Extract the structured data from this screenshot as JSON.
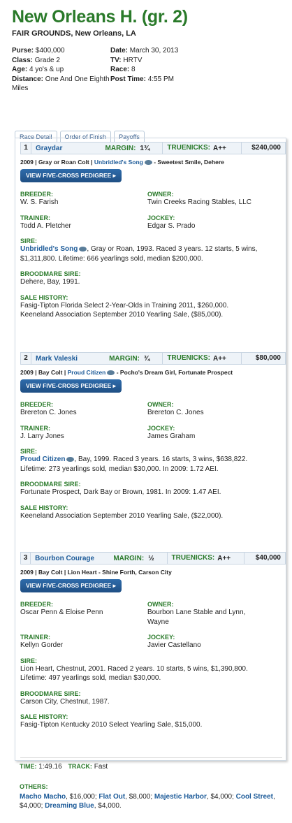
{
  "title": "New Orleans H. (gr. 2)",
  "location": "FAIR GROUNDS, New Orleans, LA",
  "info": {
    "purse_label": "Purse:",
    "purse": "$400,000",
    "class_label": "Class:",
    "class": "Grade 2",
    "age_label": "Age:",
    "age": "4 yo's & up",
    "distance_label": "Distance:",
    "distance": "One And One Eighth Miles",
    "date_label": "Date:",
    "date": "March 30, 2013",
    "tv_label": "TV:",
    "tv": "HRTV",
    "race_label": "Race:",
    "race": "8",
    "post_label": "Post Time:",
    "post": "4:55 PM"
  },
  "tabs": [
    "Race Detail",
    "Order of Finish",
    "Payoffs"
  ],
  "labels": {
    "margin": "MARGIN:",
    "truenicks": "TRUENICKS:",
    "pedigree_btn": "VIEW FIVE-CROSS PEDIGREE ▸",
    "breeder": "BREEDER:",
    "owner": "OWNER:",
    "trainer": "TRAINER:",
    "jockey": "JOCKEY:",
    "sire": "SIRE:",
    "broodmare": "BROODMARE SIRE:",
    "sale": "SALE HISTORY:"
  },
  "horses": [
    {
      "pos": "1",
      "name": "Graydar",
      "margin": "1¾",
      "truenicks": "A++",
      "prize": "$240,000",
      "ped_prefix": "2009 | Gray or Roan Colt | ",
      "ped_sire": "Unbridled's Song",
      "ped_rest": " - Sweetest Smile, Dehere",
      "breeder": "W. S. Farish",
      "owner": "Twin Creeks Racing Stables, LLC",
      "trainer": "Todd A. Pletcher",
      "jockey": "Edgar S. Prado",
      "sire_name": "Unbridled's Song",
      "sire_line1": ", Gray or Roan, 1993. Raced 3 years. 12 starts, 5 wins,",
      "sire_line2": "$1,311,800. Lifetime: 666 yearlings sold, median $200,000.",
      "broodmare": "Dehere, Bay, 1991.",
      "sale1": "Fasig-Tipton Florida Select 2-Year-Olds in Training 2011, $260,000.",
      "sale2": "Keeneland Association September 2010 Yearling Sale, ($85,000)."
    },
    {
      "pos": "2",
      "name": "Mark Valeski",
      "margin": "¾",
      "truenicks": "A++",
      "prize": "$80,000",
      "ped_prefix": "2009 | Bay Colt | ",
      "ped_sire": "Proud Citizen",
      "ped_rest": " - Pocho's Dream Girl, Fortunate Prospect",
      "breeder": "Brereton C. Jones",
      "owner": "Brereton C. Jones",
      "trainer": "J. Larry Jones",
      "jockey": "James Graham",
      "sire_name": "Proud Citizen",
      "sire_line1": ", Bay, 1999. Raced 3 years. 16 starts, 3 wins, $638,822.",
      "sire_line2": "Lifetime: 273 yearlings sold, median $30,000. In 2009: 1.72 AEI.",
      "broodmare": "Fortunate Prospect, Dark Bay or Brown, 1981. In 2009: 1.47 AEI.",
      "sale1": "Keeneland Association September 2010 Yearling Sale, ($22,000).",
      "sale2": ""
    },
    {
      "pos": "3",
      "name": "Bourbon Courage",
      "margin": "½",
      "truenicks": "A++",
      "prize": "$40,000",
      "ped_prefix": "2009 | Bay Colt | Lion Heart - Shine Forth, Carson City",
      "breeder": "Oscar Penn & Eloise Penn",
      "owner1": "Bourbon Lane Stable and Lynn,",
      "owner2": "Wayne",
      "trainer": "Kellyn Gorder",
      "jockey": "Javier Castellano",
      "sire_line1": "Lion Heart, Chestnut, 2001. Raced 2 years. 10 starts, 5 wins, $1,390,800.",
      "sire_line2": "Lifetime: 497 yearlings sold, median $30,000.",
      "broodmare": "Carson City, Chestnut, 1987.",
      "sale1": "Fasig-Tipton Kentucky 2010 Select Yearling Sale, $15,000."
    }
  ],
  "time_label": "TIME:",
  "time": "1:49.16",
  "track_label": "TRACK:",
  "track": "Fast",
  "others_label": "OTHERS:",
  "others": [
    {
      "name": "Macho Macho",
      "amt": ", $16,000; "
    },
    {
      "name": "Flat Out",
      "amt": ", $8,000; "
    },
    {
      "name": "Majestic Harbor",
      "amt": ", $4,000; "
    },
    {
      "name": "Cool Street",
      "amt": ", $4,000; "
    },
    {
      "name": "Dreaming Blue",
      "amt": ", $4,000."
    }
  ]
}
